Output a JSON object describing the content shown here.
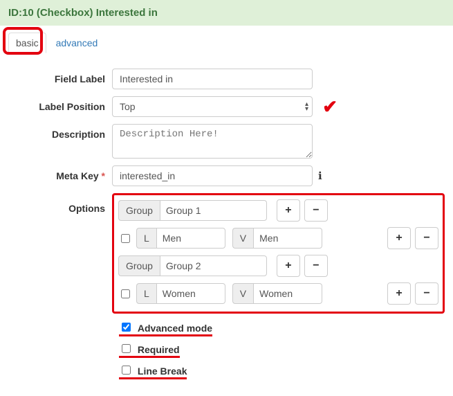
{
  "header": {
    "title": "ID:10 (Checkbox) Interested in"
  },
  "tabs": {
    "basic": "basic",
    "advanced": "advanced"
  },
  "labels": {
    "field_label": "Field Label",
    "label_position": "Label Position",
    "description": "Description",
    "meta_key": "Meta Key",
    "options": "Options"
  },
  "values": {
    "field_label": "Interested in",
    "label_position": "Top",
    "description_placeholder": "Description Here!",
    "meta_key": "interested_in"
  },
  "addons": {
    "group": "Group",
    "l": "L",
    "v": "V"
  },
  "options": {
    "groups": [
      {
        "name": "Group 1",
        "items": [
          {
            "l": "Men",
            "v": "Men"
          }
        ]
      },
      {
        "name": "Group 2",
        "items": [
          {
            "l": "Women",
            "v": "Women"
          }
        ]
      }
    ]
  },
  "checks": {
    "advanced_mode": {
      "label": "Advanced mode",
      "checked": true
    },
    "required": {
      "label": "Required",
      "checked": false
    },
    "line_break": {
      "label": "Line Break",
      "checked": false
    }
  },
  "symbols": {
    "req_star": "*",
    "info": "ℹ",
    "plus": "+",
    "minus": "−",
    "caret_up": "▴",
    "caret_down": "▾",
    "check": "✔"
  }
}
